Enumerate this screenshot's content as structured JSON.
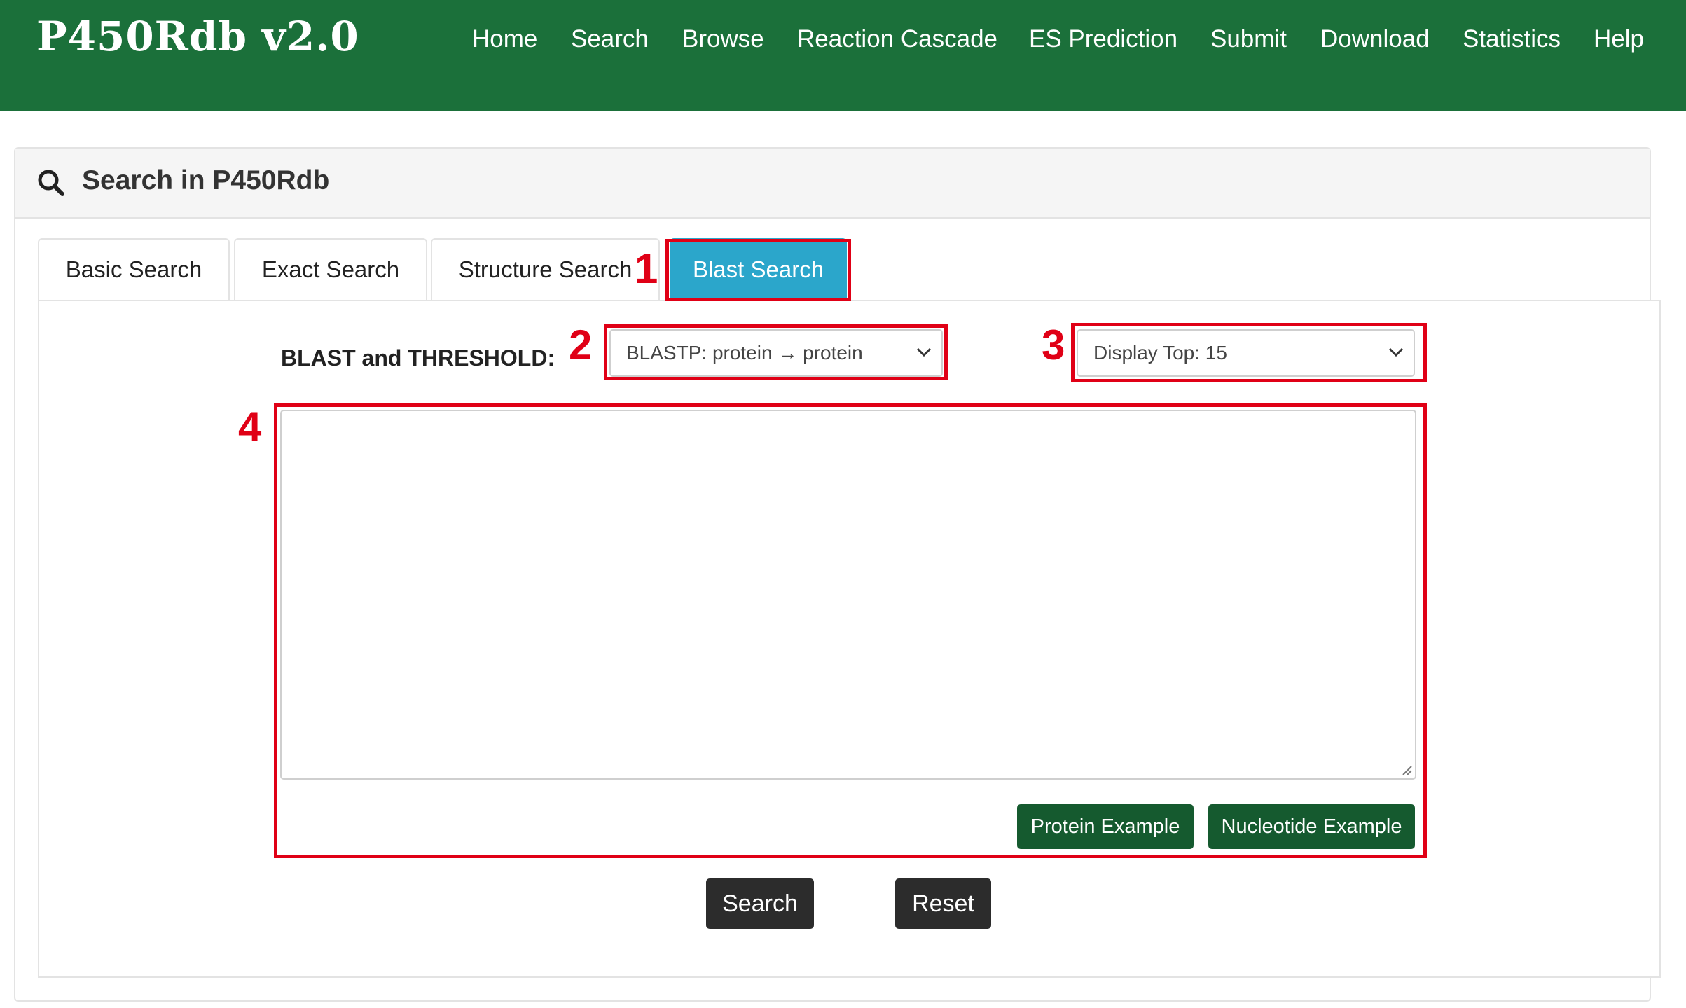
{
  "brand": "P450Rdb v2.0",
  "nav": [
    "Home",
    "Search",
    "Browse",
    "Reaction Cascade",
    "ES Prediction",
    "Submit",
    "Download",
    "Statistics",
    "Help"
  ],
  "panel": {
    "title": "Search in P450Rdb"
  },
  "tabs": [
    "Basic Search",
    "Exact Search",
    "Structure Search",
    "Blast Search"
  ],
  "form": {
    "label": "BLAST and THRESHOLD:",
    "blast_select": "BLASTP: protein → protein",
    "display_select": "Display Top: 15",
    "sequence_value": "",
    "protein_example": "Protein Example",
    "nucleotide_example": "Nucleotide Example",
    "search": "Search",
    "reset": "Reset"
  },
  "annotations": [
    "1",
    "2",
    "3",
    "4"
  ],
  "colors": {
    "navbar": "#1b703a",
    "active_tab": "#2ba6cb",
    "example_button": "#155a2f",
    "annotation": "#e00016"
  }
}
